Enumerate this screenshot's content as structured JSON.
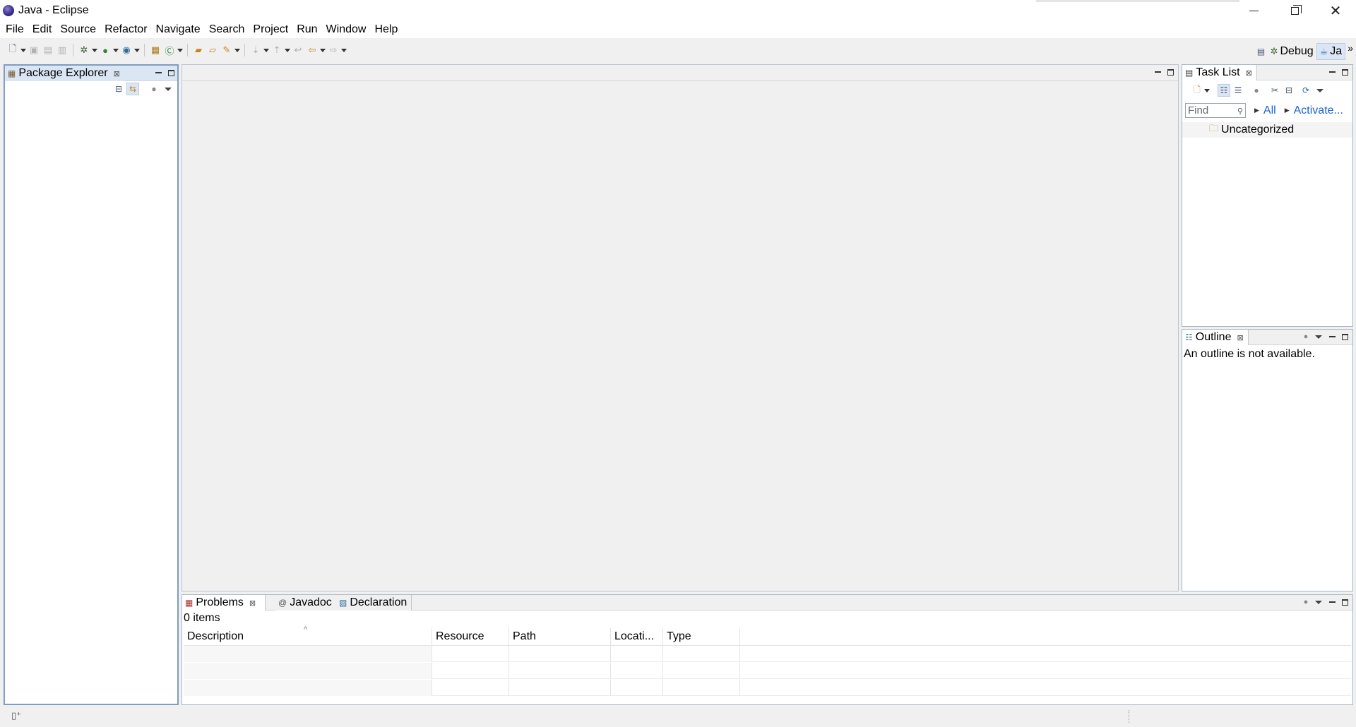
{
  "window": {
    "title": "Java - Eclipse"
  },
  "menubar": {
    "items": [
      "File",
      "Edit",
      "Source",
      "Refactor",
      "Navigate",
      "Search",
      "Project",
      "Run",
      "Window",
      "Help"
    ]
  },
  "perspectives": {
    "debug_label": "Debug",
    "java_label": "Ja"
  },
  "package_explorer": {
    "tab_label": "Package Explorer"
  },
  "task_list": {
    "tab_label": "Task List",
    "find_placeholder": "Find",
    "all_label": "All",
    "activate_label": "Activate...",
    "category": "Uncategorized"
  },
  "outline": {
    "tab_label": "Outline",
    "message": "An outline is not available."
  },
  "bottom_panel": {
    "tabs": [
      "Problems",
      "Javadoc",
      "Declaration"
    ],
    "items_count": "0 items",
    "columns": [
      "Description",
      "Resource",
      "Path",
      "Locati...",
      "Type"
    ]
  }
}
